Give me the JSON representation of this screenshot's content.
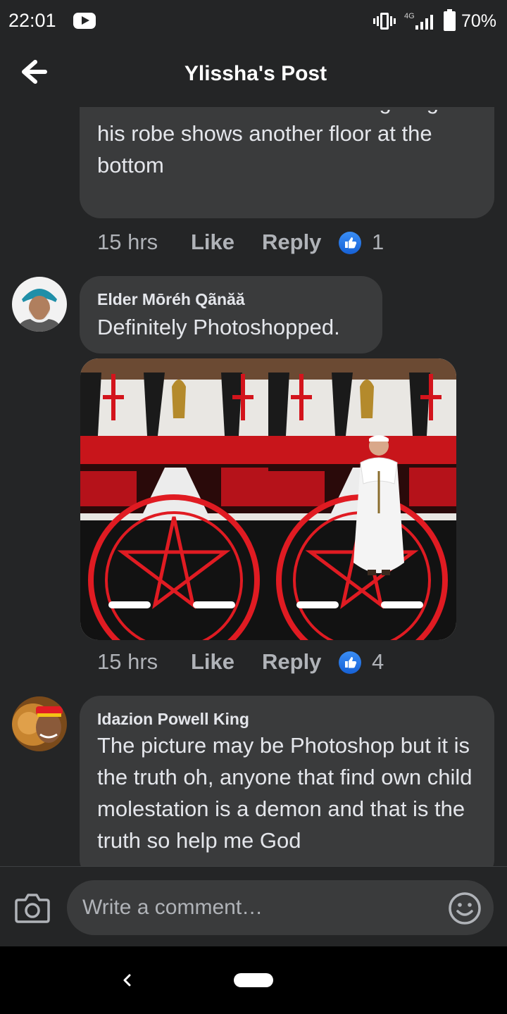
{
  "status_bar": {
    "time": "22:01",
    "network": "4G",
    "battery": "70%",
    "icons": [
      "youtube-icon",
      "vibrate-icon",
      "signal-icon",
      "battery-icon"
    ]
  },
  "header": {
    "title": "Ylissha's Post",
    "back_icon": "arrow-left-icon"
  },
  "comments": [
    {
      "author": "",
      "text": "doesn't blend with the room lighting and his robe shows another floor at the bottom",
      "time": "15 hrs",
      "like": "Like",
      "reply": "Reply",
      "reactions": "1"
    },
    {
      "author": "Elder Mōréh Qãnăă",
      "text": "Definitely Photoshopped.",
      "time": "15 hrs",
      "like": "Like",
      "reply": "Reply",
      "reactions": "4",
      "has_image": true
    },
    {
      "author": "Idazion Powell King",
      "text": "The picture may be Photoshop but it is the truth oh, anyone that find own child molestation is a demon and that is the truth so help me God"
    }
  ],
  "composer": {
    "placeholder": "Write a comment…",
    "camera_icon": "camera-icon",
    "emoji_icon": "emoji-icon"
  },
  "colors": {
    "background": "#242526",
    "bubble": "#3a3b3c",
    "text_primary": "#e4e6eb",
    "text_secondary": "#b0b3b8",
    "like_blue": "#1877f2"
  }
}
